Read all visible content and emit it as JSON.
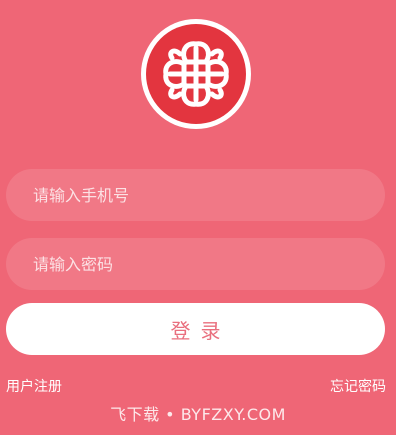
{
  "theme": {
    "background": "#ef6676",
    "accent": "#e3353f",
    "button_text": "#e96f7e"
  },
  "logo": {
    "icon": "ornamental-knot-emblem-icon"
  },
  "form": {
    "phone_placeholder": "请输入手机号",
    "password_placeholder": "请输入密码",
    "login_label": "登录"
  },
  "links": {
    "register": "用户注册",
    "forgot_password": "忘记密码"
  },
  "watermark": {
    "text": "飞下载 • BYFZXY.COM"
  }
}
